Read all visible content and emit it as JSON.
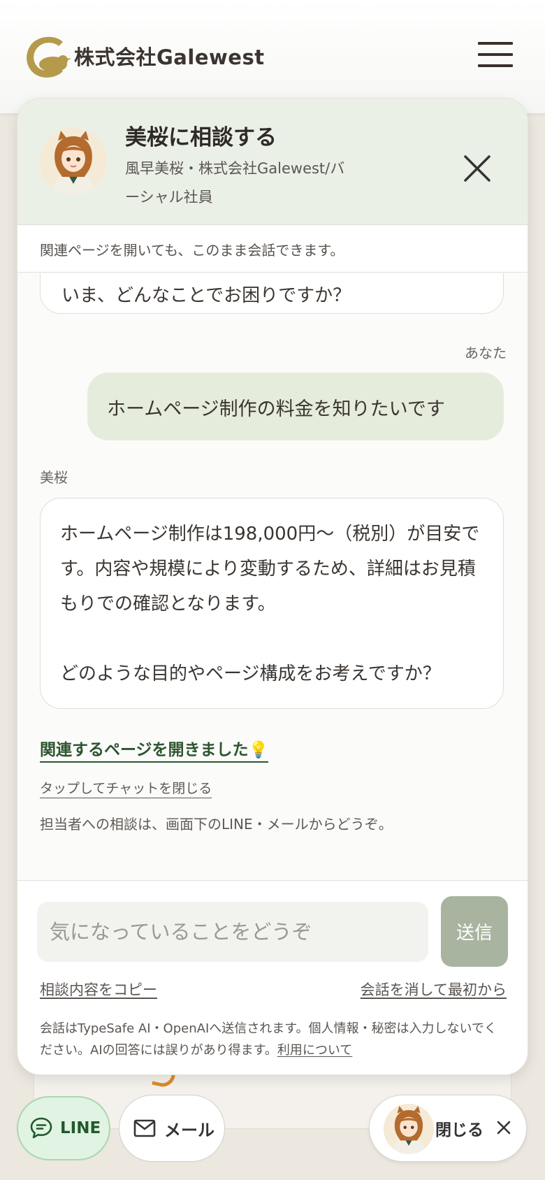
{
  "header": {
    "company_name": "株式会社Galewest",
    "menu_icon": "hamburger-icon"
  },
  "chat": {
    "title": "美桜に相談する",
    "subtitle": "風早美桜・株式会社Galewest/バーシャル社員",
    "notice": "関連ページを開いても、このまま会話できます。",
    "partial_message": "いま、どんなことでお困りですか？",
    "you_label": "あなた",
    "user_message": "ホームページ制作の料金を知りたいです",
    "bot_label": "美桜",
    "bot_message": "ホームページ制作は198,000円〜（税別）が目安です。内容や規模により変動するため、詳細はお見積もりでの確認となります。\n\nどのような目的やページ構成をお考えですか？",
    "related_link": "関連するページを開きました💡",
    "tap_close": "タップしてチャットを閉じる",
    "contact_note": "担当者への相談は、画面下のLINE・メールからどうぞ。",
    "input_placeholder": "気になっていることをどうぞ",
    "send_label": "送信",
    "copy_label": "相談内容をコピー",
    "reset_label": "会話を消して最初から",
    "disclaimer": "会話はTypeSafe AI・OpenAIへ送信されます。個人情報・秘密は入力しないでください。AIの回答には誤りがあり得ます。",
    "terms_label": "利用について"
  },
  "footer": {
    "line_label": "LINE",
    "mail_label": "メール",
    "close_label": "閉じる"
  },
  "colors": {
    "accent_green": "#2d5530",
    "header_bg": "#ebf0e6",
    "user_bubble": "#e6ecdc",
    "send_button": "#a8b4a0",
    "logo_gold": "#b49a4a"
  }
}
